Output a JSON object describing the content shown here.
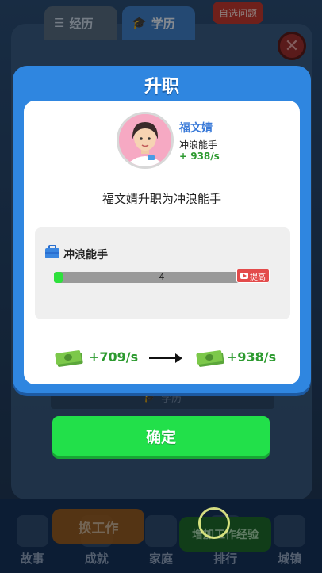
{
  "background": {
    "tabs": [
      {
        "label": "经历",
        "icon": "document-icon"
      },
      {
        "label": "学历",
        "icon": "graduation-cap-icon"
      }
    ],
    "top_button": "自选问题",
    "strip_label": "学历",
    "bottom_nav": [
      {
        "label": "故事",
        "icon": "book-icon"
      },
      {
        "label": "成就",
        "icon": "trophy-icon"
      },
      {
        "label": "家庭",
        "icon": "family-icon"
      },
      {
        "label": "排行",
        "icon": "ranking-icon"
      },
      {
        "label": "城镇",
        "icon": "town-icon"
      }
    ],
    "switch_job_button": "换工作",
    "gain_exp_button": "增加工作经验"
  },
  "modal": {
    "title": "升职",
    "character": {
      "name": "福文婧",
      "job": "冲浪能手",
      "rate": "+ 938/s"
    },
    "promotion_text": "福文婧升职为冲浪能手",
    "job_card": {
      "title": "冲浪能手",
      "progress_label": "4",
      "progress_fraction": 0.04,
      "boost_label": "提高"
    },
    "income": {
      "old": "+709/s",
      "new": "+938/s"
    },
    "confirm_label": "确定"
  },
  "colors": {
    "modal_blue": "#2f86e0",
    "confirm_green": "#22e04a",
    "income_green": "#2c9a2f",
    "name_blue": "#3a7ad8",
    "boost_red": "#e34b4b"
  }
}
